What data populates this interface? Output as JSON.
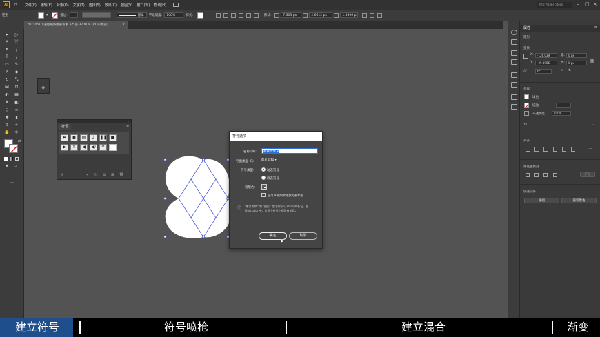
{
  "menubar": {
    "logo": "Ai",
    "items": [
      "文件(F)",
      "编辑(E)",
      "对象(O)",
      "文字(T)",
      "选择(S)",
      "效果(C)",
      "视图(V)",
      "窗口(W)",
      "帮助(H)"
    ],
    "search_placeholder": "搜索 Adobe Stock"
  },
  "control_bar": {
    "object_type": "矩形",
    "stroke_label": "描边:",
    "stroke_profile": "基本",
    "opacity_label": "不透明度:",
    "opacity_value": "100%",
    "style_label": "样式:",
    "shape_label": "形状:",
    "width_value": "7.303 px",
    "height_value": "2.6612 px",
    "angle_value": "1.3306 px"
  },
  "document_tab": {
    "title": "20210510 道程矩阵图形拆解.ai* @ 3200 % (RGB/预览)",
    "close": "×"
  },
  "properties_panel": {
    "tab_title": "属性",
    "object_type": "矩形",
    "transform_header": "变换",
    "x_label": "X:",
    "x_value": "-126.039",
    "y_label": "Y:",
    "y_value": "-29.8906",
    "w_label": "宽:",
    "w_value": "0 px",
    "h_label": "高:",
    "h_value": "0 px",
    "angle_label": "△:",
    "angle_value": "0°",
    "appearance_header": "外观",
    "fill_label": "填色",
    "stroke_label": "描边",
    "opacity_label": "不透明度",
    "opacity_value": "100%",
    "fx_label": "fx.",
    "align_header": "对齐",
    "pathfinder_header": "路径查找器",
    "pathfinder_expand": "扩展",
    "quick_actions_header": "快速操作",
    "edit_button": "编组",
    "recolor_button": "重新着色"
  },
  "symbols_panel": {
    "title": "符号",
    "menu_icon": "≡",
    "collapse": "«",
    "close": "×"
  },
  "symbol_options_dialog": {
    "title": "符号选项",
    "name_label": "名称 (N):",
    "name_value": "新建符号 1",
    "export_type_label": "导出类型 (E):",
    "export_type_value": "影片剪辑",
    "symbol_type_label": "符号类型:",
    "dynamic_symbol": "动态符号",
    "static_symbol": "静态符号",
    "registration_label": "套版色:",
    "nine_slice_label": "启用 9 格切片缩放的参考线",
    "info_text": "\"影片剪辑\" 和 \"图形\" 是用来导入 Flash 的标记。在 Illustrator 中，这两个符号之间没有差异。",
    "ok_button": "确定",
    "cancel_button": "取消"
  },
  "subtitle_bar": {
    "items": [
      "建立符号",
      "符号喷枪",
      "建立混合",
      "渐变"
    ],
    "highlight_color": "#1f4e8c"
  },
  "colors": {
    "ui_dark": "#323232",
    "panel": "#3c3c3c",
    "canvas": "#535353",
    "selection": "#4b5bd6",
    "dialog_field_highlight": "#2f6fd6"
  }
}
